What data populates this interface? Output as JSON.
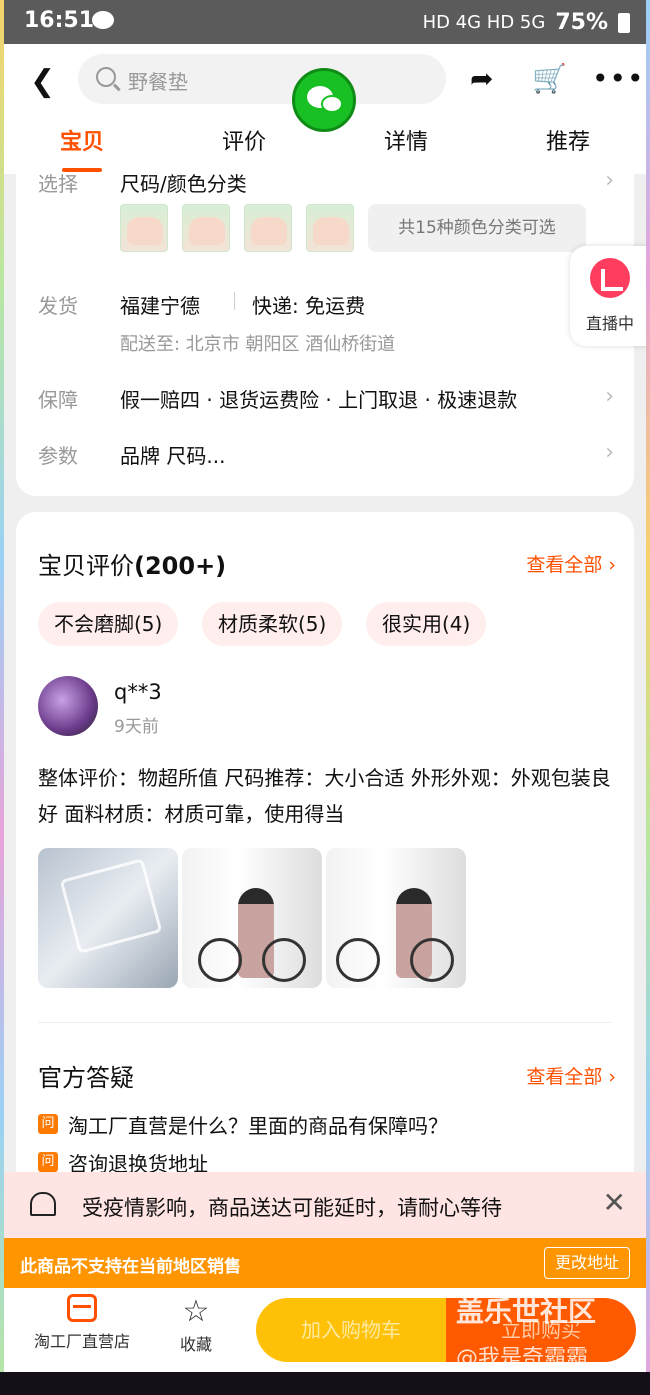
{
  "status_bar": {
    "time": "16:51",
    "indicators": "HD 4G HD 5G",
    "battery": "75%"
  },
  "header": {
    "search_placeholder": "野餐垫",
    "tabs": [
      "宝贝",
      "评价",
      "详情",
      "推荐"
    ],
    "active_tab": "宝贝"
  },
  "product": {
    "select_label": "选择",
    "select_value": "尺码/颜色分类",
    "color_note": "共15种颜色分类可选",
    "shipping_label": "发货",
    "shipping_from": "福建宁德",
    "shipping_fee": "快递: 免运费",
    "delivery_to": "配送至: 北京市 朝阳区 酒仙桥街道",
    "guarantee_label": "保障",
    "guarantee_value": "假一赔四 · 退货运费险 · 上门取退 · 极速退款",
    "params_label": "参数",
    "params_value": "品牌 尺码..."
  },
  "live_badge": "直播中",
  "reviews": {
    "title": "宝贝评价",
    "count": "(200+)",
    "see_all": "查看全部",
    "tags": [
      "不会磨脚(5)",
      "材质柔软(5)",
      "很实用(4)"
    ],
    "user": "q**3",
    "time": "9天前",
    "text": "整体评价：物超所值 尺码推荐：大小合适 外形外观：外观包装良好 面料材质：材质可靠，使用得当"
  },
  "qa": {
    "title": "官方答疑",
    "see_all": "查看全部",
    "icon_label": "问",
    "items": [
      "淘工厂直营是什么？里面的商品有保障吗？",
      "咨询退换货地址"
    ]
  },
  "notice": "受疫情影响，商品送达可能延时，请耐心等待",
  "region": {
    "text": "此商品不支持在当前地区销售",
    "button": "更改地址"
  },
  "bottom": {
    "store": "淘工厂直营店",
    "favorite": "收藏",
    "add_cart": "加入购物车",
    "buy_now": "立即购买"
  },
  "watermark": {
    "line1": "盖乐世社区",
    "line2": "@我是奇霸霸"
  },
  "colors": {
    "accent": "#ff5000",
    "cart": "#ffc107",
    "region": "#ff9500"
  }
}
